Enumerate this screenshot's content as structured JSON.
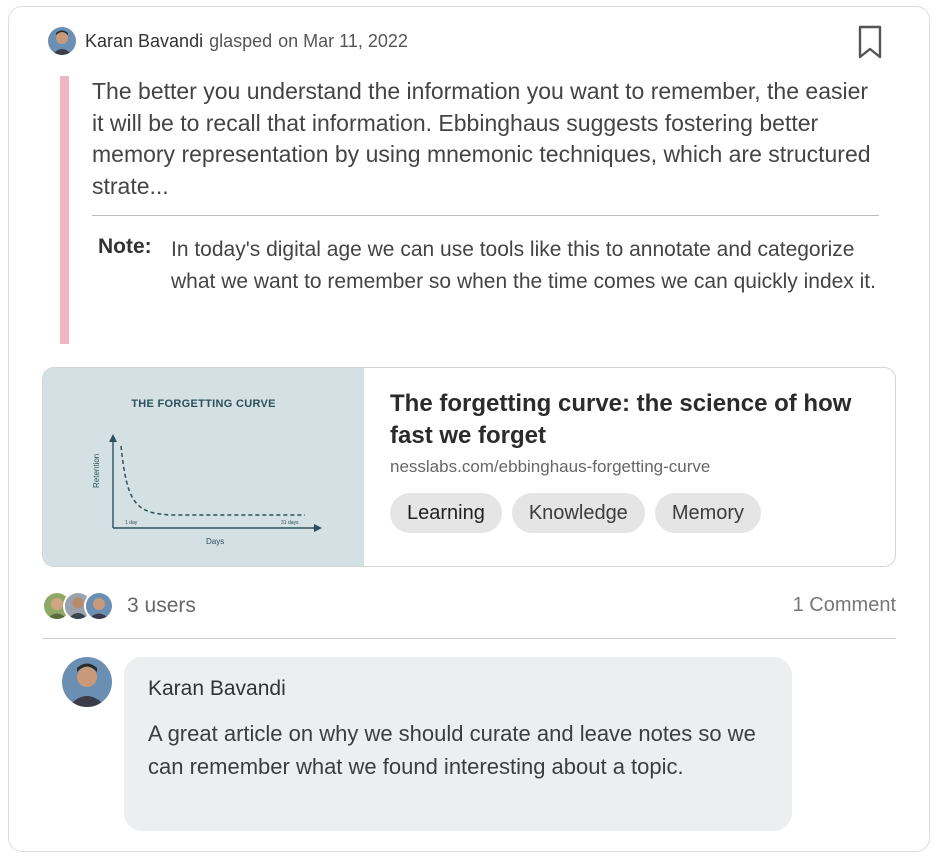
{
  "post": {
    "author": "Karan Bavandi",
    "action": "glasped",
    "date": "on Mar 11, 2022",
    "quote": "The better you understand the information you want to remember, the easier it will be to recall that information. Ebbinghaus suggests fostering better memory representation by using mnemonic techniques, which are structured strate...",
    "note_label": "Note:",
    "note_text": "In today's digital age we can use tools like this to annotate and categorize what we want to remember so when the time comes we can quickly index it."
  },
  "link": {
    "thumbnail_title": "THE FORGETTING CURVE",
    "thumbnail_ylabel": "Retention",
    "thumbnail_xlabel": "Days",
    "thumbnail_tick_start": "1 day",
    "thumbnail_tick_end": "31 days",
    "title": "The forgetting curve: the science of how fast we forget",
    "url": "nesslabs.com/ebbinghaus-forgetting-curve",
    "tags": [
      "Learning",
      "Knowledge",
      "Memory"
    ]
  },
  "activity": {
    "users_label": "3 users",
    "comments_label": "1 Comment"
  },
  "comment": {
    "author": "Karan Bavandi",
    "text": "A great article on why we should curate and leave notes so we can remember what we found interesting about a topic."
  },
  "colors": {
    "quote_bar": "#efb6c3",
    "thumbnail_bg": "#d3e0e4",
    "tag_bg": "#e5e5e5",
    "comment_bg": "#eceef0"
  },
  "icons": {
    "bookmark": "bookmark-icon",
    "avatar": "avatar"
  }
}
